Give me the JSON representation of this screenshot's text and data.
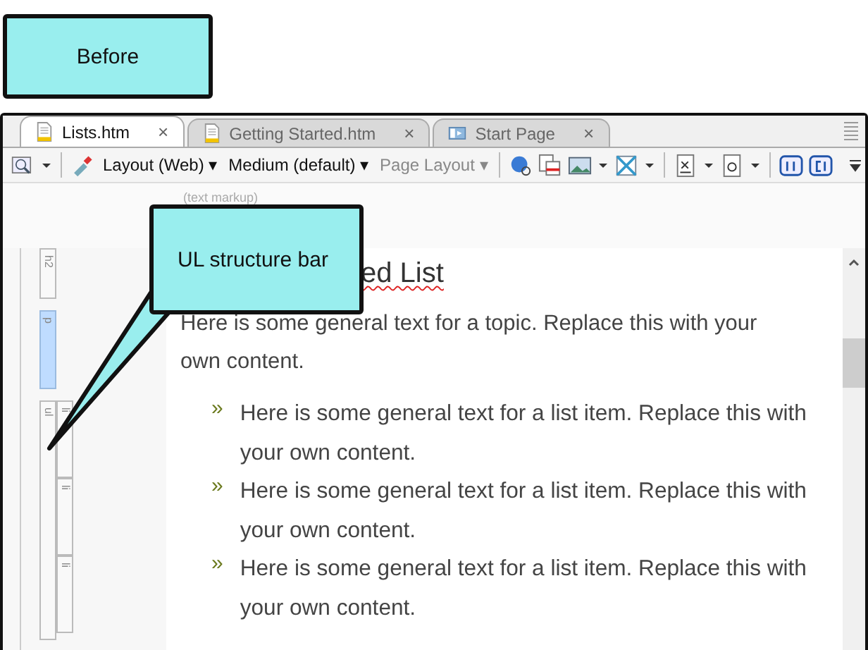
{
  "callouts": [
    {
      "kind": "plain",
      "text": "Before"
    },
    {
      "kind": "pointer",
      "text": "UL structure bar"
    }
  ],
  "tabs": [
    {
      "label": "Lists.htm",
      "kind": "document",
      "selected": true,
      "close": "×"
    },
    {
      "label": "Getting Started.htm",
      "kind": "document",
      "selected": false,
      "close": "×"
    },
    {
      "label": "Start Page",
      "kind": "start",
      "selected": false,
      "close": "×"
    }
  ],
  "toolbar": {
    "dropdowns": [
      {
        "label": "Layout (Web)",
        "caret": "▾",
        "disabled": false
      },
      {
        "label": "Medium (default)",
        "caret": "▾",
        "disabled": false
      },
      {
        "label": "Page Layout",
        "caret": "▾",
        "disabled": true
      }
    ]
  },
  "markup_hint": "(text markup)",
  "structure_bars": [
    {
      "label": "h2",
      "selected": false
    },
    {
      "label": "p",
      "selected": true
    },
    {
      "label": "ul",
      "selected": false,
      "children": [
        {
          "label": "li"
        },
        {
          "label": "li"
        },
        {
          "label": "li"
        }
      ]
    }
  ],
  "document": {
    "heading": "ed List",
    "heading_spellcheck": true,
    "paragraph": "Here is some general text for a topic. Replace this with your own content.",
    "list_items": [
      {
        "bullet": "»",
        "text": "Here is some general text for a list item. Replace this with your own content."
      },
      {
        "bullet": "»",
        "text": "Here is some general text for a list item. Replace this with your own content."
      },
      {
        "bullet": "»",
        "text": "Here is some general text for a list item. Replace this with your own content."
      }
    ]
  }
}
